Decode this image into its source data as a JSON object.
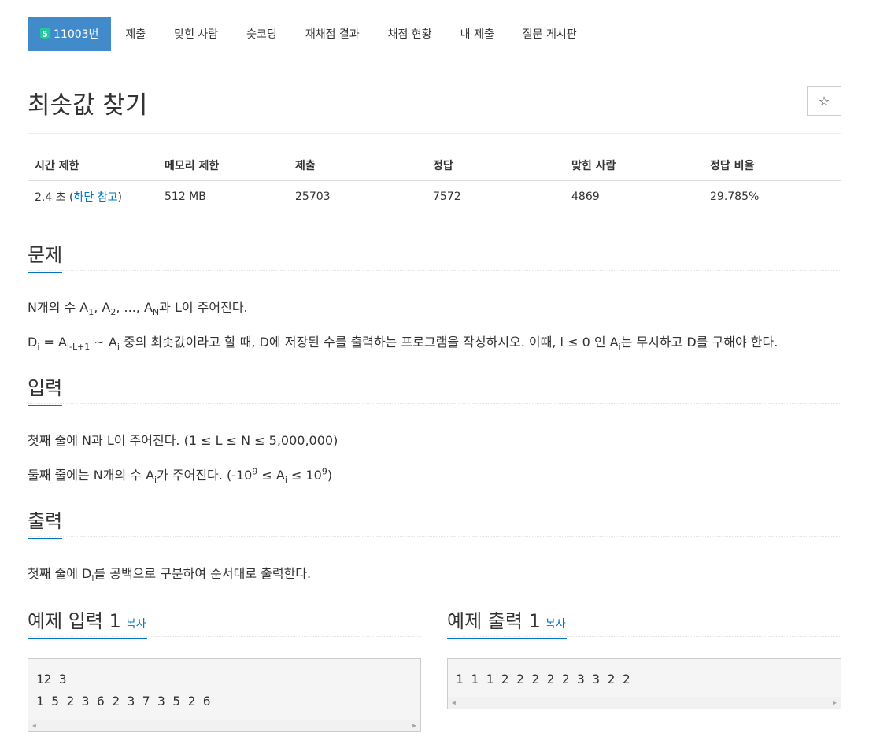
{
  "tabs": {
    "problem_number": "11003번",
    "badge": "5",
    "items": [
      "제출",
      "맞힌 사람",
      "숏코딩",
      "재채점 결과",
      "채점 현황",
      "내 제출",
      "질문 게시판"
    ]
  },
  "problem": {
    "title": "최솟값 찾기",
    "star": "☆"
  },
  "info": {
    "headers": [
      "시간 제한",
      "메모리 제한",
      "제출",
      "정답",
      "맞힌 사람",
      "정답 비율"
    ],
    "time_value": "2.4 초 (",
    "time_link": "하단 참고",
    "time_close": ")",
    "memory": "512 MB",
    "submissions": "25703",
    "accepted": "7572",
    "solvers": "4869",
    "ratio": "29.785%"
  },
  "sections": {
    "description": "문제",
    "input": "입력",
    "output": "출력",
    "sample_input": "예제 입력 1",
    "sample_output": "예제 출력 1",
    "copy": "복사"
  },
  "text": {
    "desc1": [
      "N개의 수 A",
      "1",
      ", A",
      "2",
      ", ..., A",
      "N",
      "과 L이 주어진다."
    ],
    "desc2": [
      "D",
      "i",
      " = A",
      "i-L+1",
      " ~ A",
      "i",
      " 중의 최솟값이라고 할 때, D에 저장된 수를 출력하는 프로그램을 작성하시오. 이때, i ≤ 0 인 A",
      "i",
      "는 무시하고 D를 구해야 한다."
    ],
    "input1": "첫째 줄에 N과 L이 주어진다. (1 ≤ L ≤ N ≤ 5,000,000)",
    "input2": [
      "둘째 줄에는 N개의 수 A",
      "i",
      "가 주어진다. (-10",
      "9",
      " ≤ A",
      "i",
      " ≤ 10",
      "9",
      ")"
    ],
    "output1": [
      "첫째 줄에 D",
      "i",
      "를 공백으로 구분하여 순서대로 출력한다."
    ]
  },
  "samples": {
    "input": "12 3\n1 5 2 3 6 2 3 7 3 5 2 6",
    "output": "1 1 1 2 2 2 2 2 3 3 2 2"
  }
}
